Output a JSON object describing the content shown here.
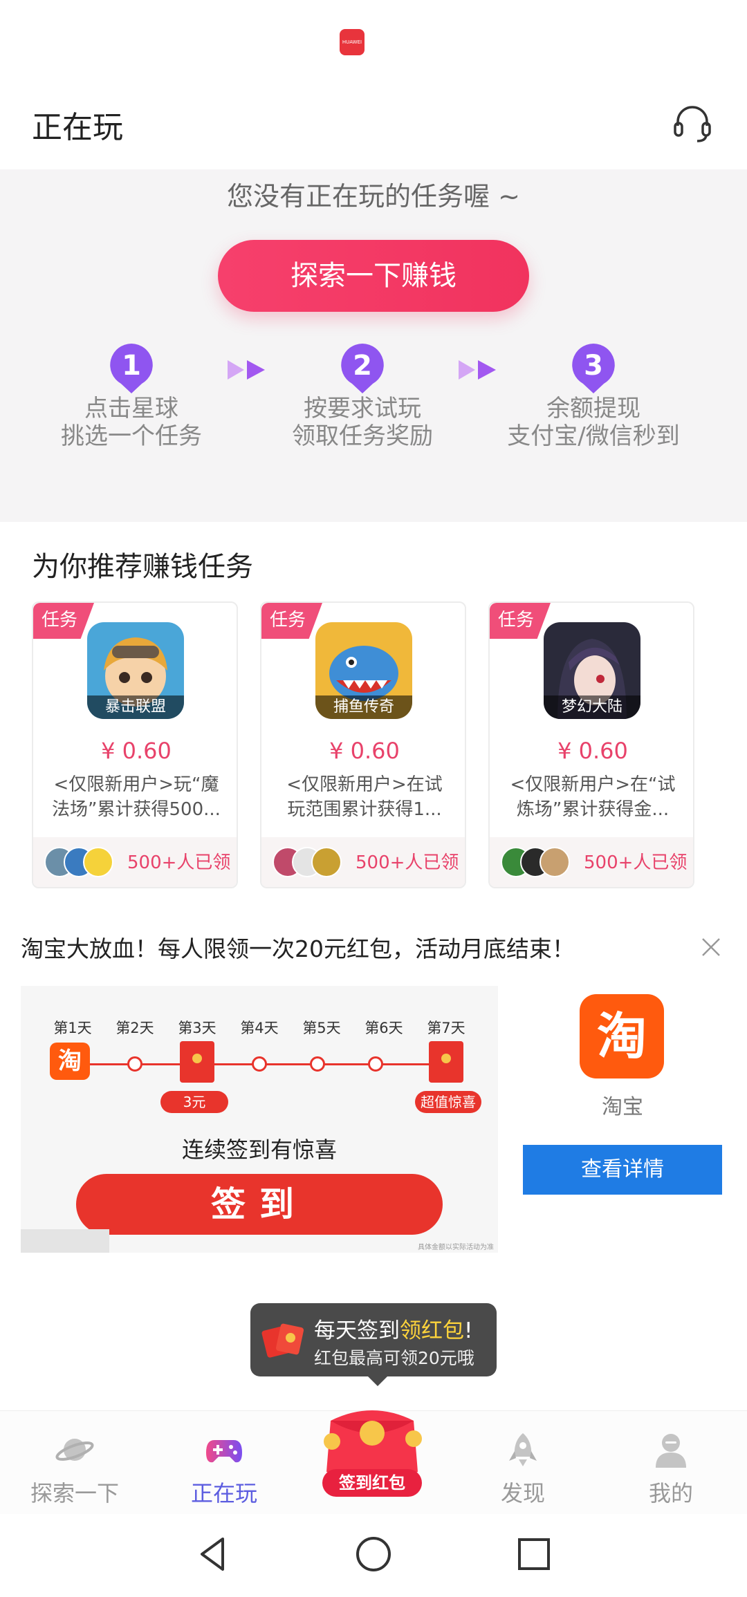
{
  "status_bar": {
    "logo_text": "HUAWEI"
  },
  "header": {
    "title": "正在玩"
  },
  "empty_state": {
    "message": "您没有正在玩的任务喔 ~",
    "explore_button": "探索一下赚钱",
    "steps": [
      {
        "number": "1",
        "line1": "点击星球",
        "line2": "挑选一个任务"
      },
      {
        "number": "2",
        "line1": "按要求试玩",
        "line2": "领取任务奖励"
      },
      {
        "number": "3",
        "line1": "余额提现",
        "line2": "支付宝/微信秒到"
      }
    ]
  },
  "recommend": {
    "title": "为你推荐赚钱任务",
    "cards": [
      {
        "badge": "任务",
        "game_name": "暴击联盟",
        "price": "¥ 0.60",
        "description": "<仅限新用户>玩“魔法场”累计获得500...",
        "claimed": "500+人已领"
      },
      {
        "badge": "任务",
        "game_name": "捕鱼传奇",
        "price": "¥ 0.60",
        "description": "<仅限新用户>在试玩范围累计获得1...",
        "claimed": "500+人已领"
      },
      {
        "badge": "任务",
        "game_name": "梦幻大陆",
        "price": "¥ 0.60",
        "description": "<仅限新用户>在“试炼场”累计获得金...",
        "claimed": "500+人已领"
      }
    ]
  },
  "ad": {
    "headline": "淘宝大放血！每人限领一次20元红包，活动月底结束！",
    "days": [
      "第1天",
      "第2天",
      "第3天",
      "第4天",
      "第5天",
      "第6天",
      "第7天"
    ],
    "tao_char": "淘",
    "tag_day3": "3元",
    "tag_day7": "超值惊喜",
    "subtitle": "连续签到有惊喜",
    "signin_button": "签到",
    "fine_print": "具体金额以实际活动为准",
    "app_name": "淘宝",
    "detail_button": "查看详情"
  },
  "tooltip": {
    "line1_prefix": "每天签到",
    "line1_highlight": "领红包",
    "line1_suffix": "!",
    "line2": "红包最高可领20元哦"
  },
  "tabbar": {
    "tabs": [
      {
        "label": "探索一下",
        "icon": "planet-icon"
      },
      {
        "label": "正在玩",
        "icon": "gamepad-icon",
        "active": true
      },
      {
        "label": "发现",
        "icon": "rocket-icon"
      },
      {
        "label": "我的",
        "icon": "user-icon"
      }
    ],
    "center_label": "签到红包"
  },
  "colors": {
    "accent_pink": "#f1335e",
    "accent_purple": "#8f55f0",
    "active_tab": "#5c5de0",
    "taobao_orange": "#ff5a0e",
    "ad_red": "#e8342c",
    "detail_blue": "#1f7ce4"
  }
}
